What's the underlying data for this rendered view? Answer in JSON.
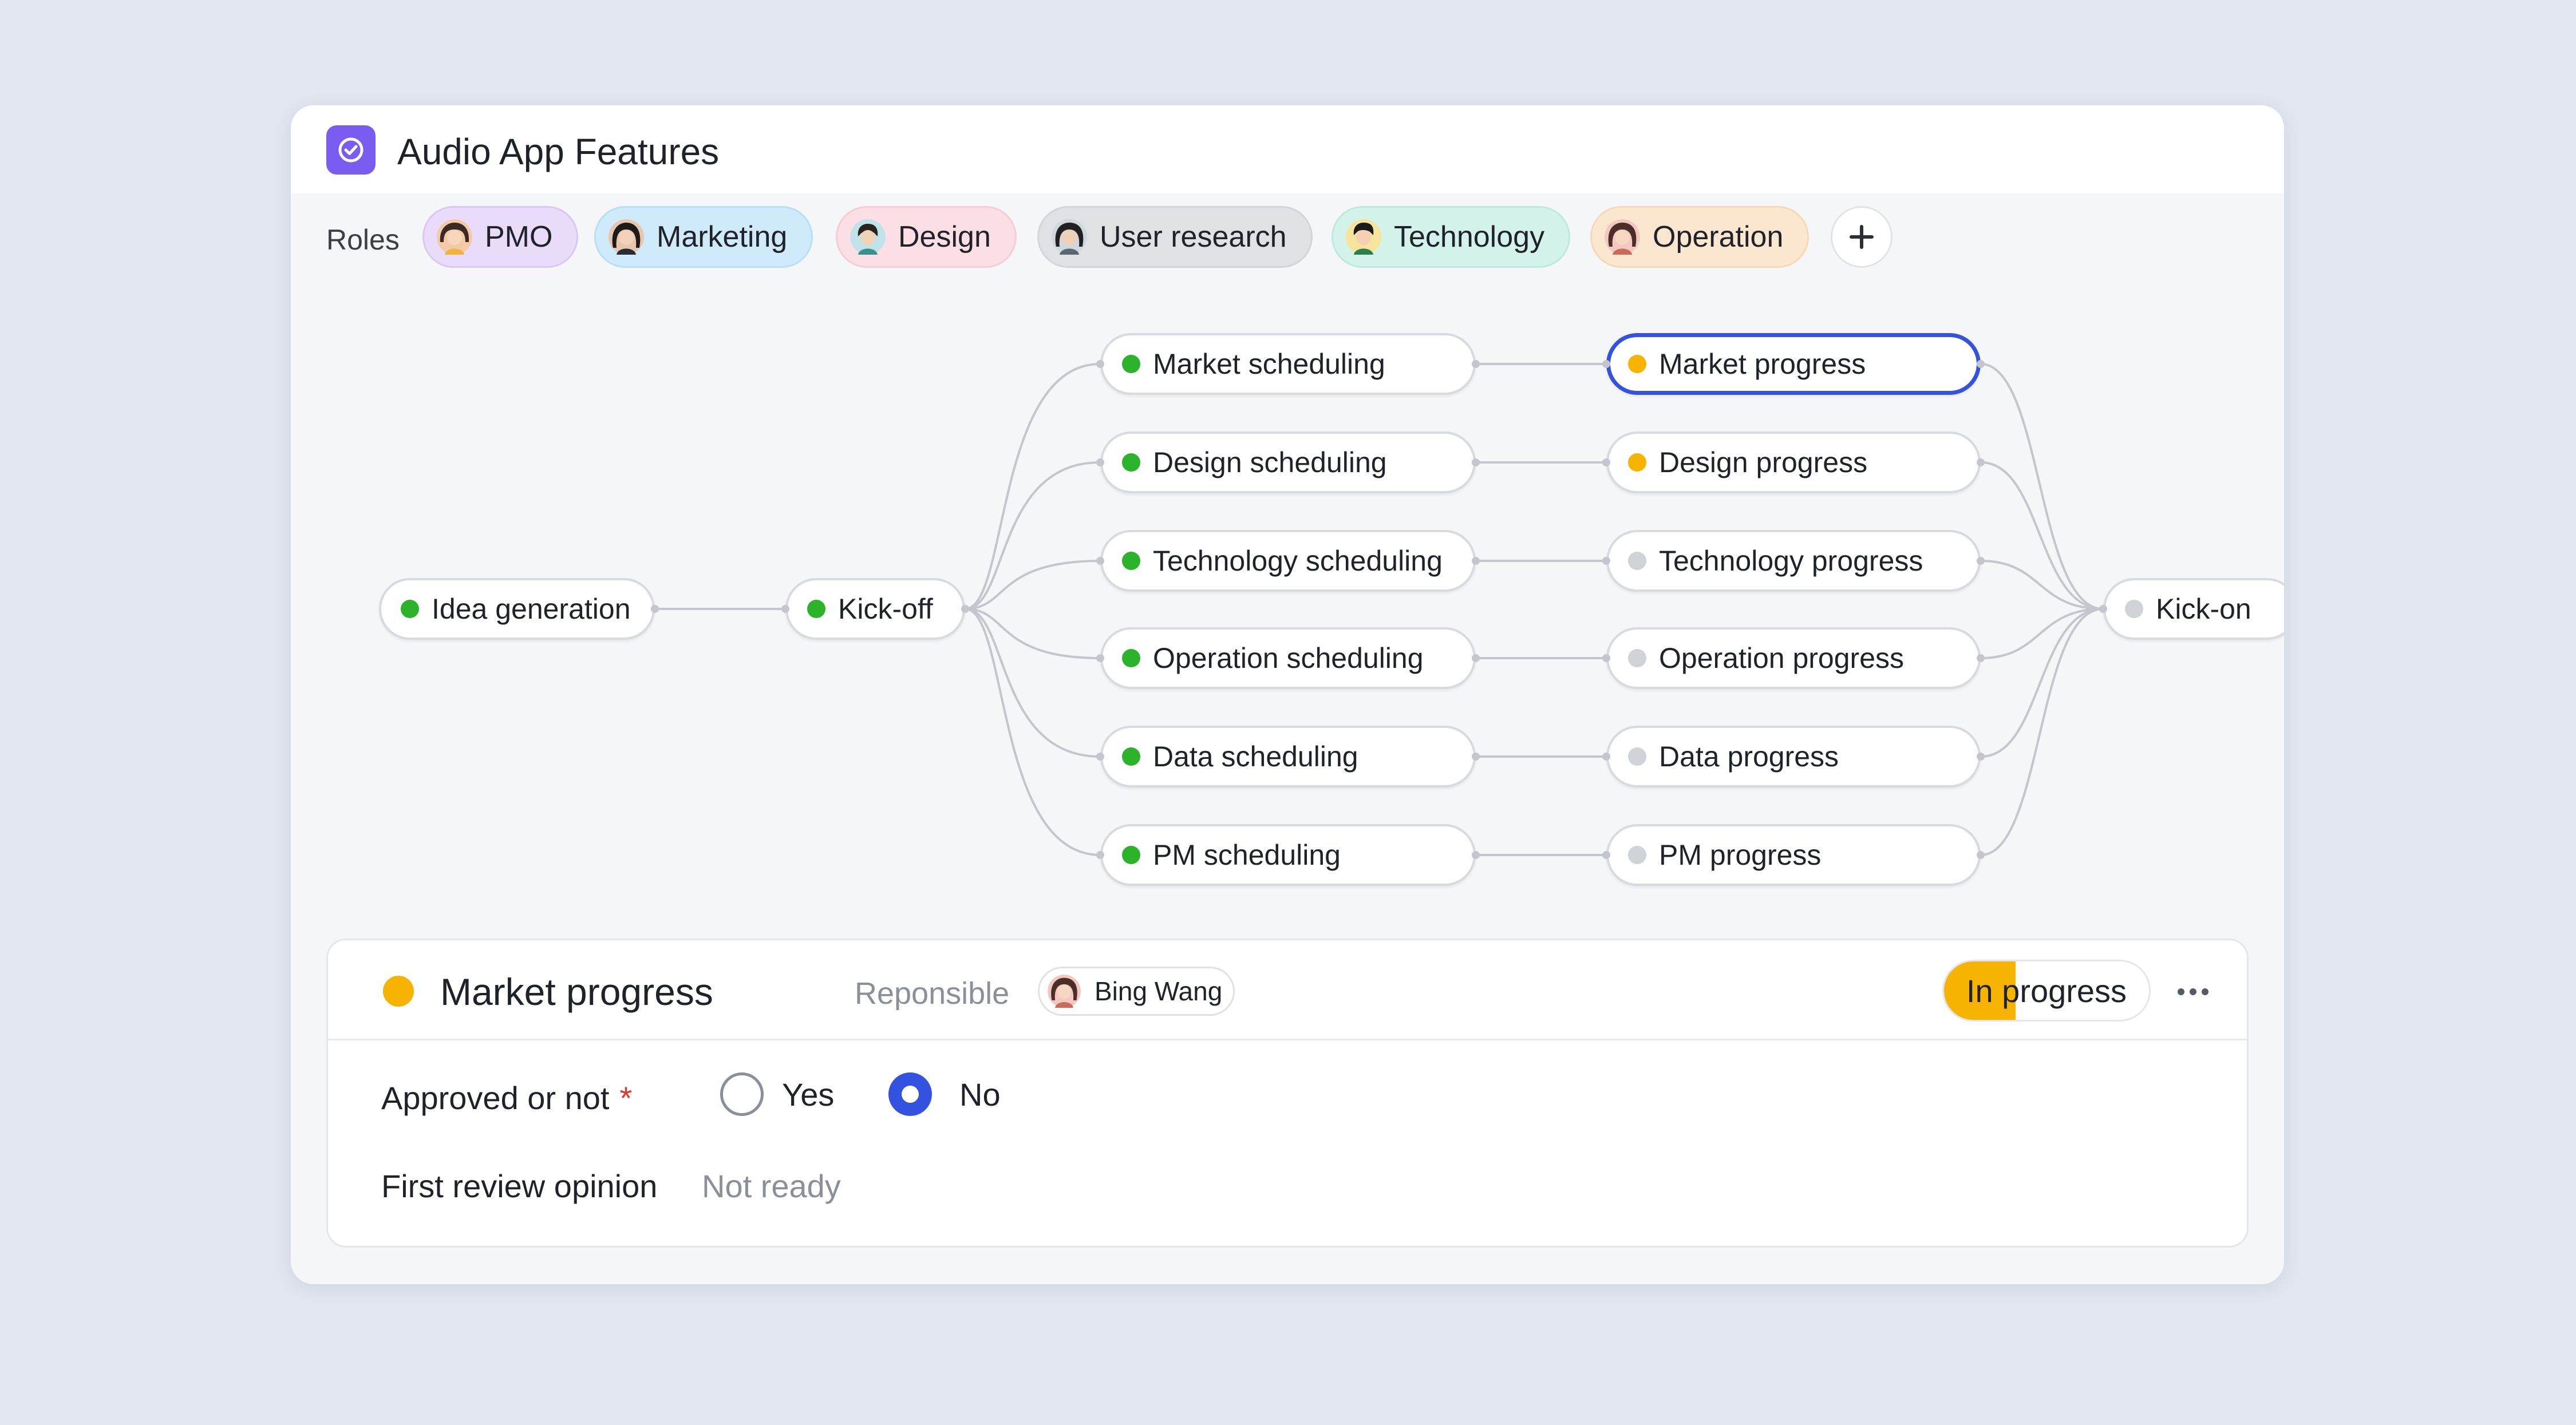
{
  "app": {
    "title": "Audio App Features",
    "icon": "check-circle-icon",
    "accent": "#7b5cf0"
  },
  "roles": {
    "label": "Roles",
    "items": [
      {
        "label": "PMO",
        "bg": "#e8dcfa",
        "border": "#d9c8f5"
      },
      {
        "label": "Marketing",
        "bg": "#cfeafb",
        "border": "#b9dff7"
      },
      {
        "label": "Design",
        "bg": "#fbdfe5",
        "border": "#f5cdd6"
      },
      {
        "label": "User research",
        "bg": "#dfe1e5",
        "border": "#d2d5da"
      },
      {
        "label": "Technology",
        "bg": "#d3f2ea",
        "border": "#bfe9de"
      },
      {
        "label": "Operation",
        "bg": "#fbe6cf",
        "border": "#f5d9b9"
      }
    ],
    "add_icon": "plus-icon"
  },
  "status_colors": {
    "done": "#2bb32b",
    "active": "#f6b400",
    "pending": "#cfd2d7",
    "selected": "#3452e0"
  },
  "flow": {
    "nodes": [
      {
        "id": "idea",
        "label": "Idea generation",
        "status": "done"
      },
      {
        "id": "kickoff",
        "label": "Kick-off",
        "status": "done"
      },
      {
        "id": "ms",
        "label": "Market scheduling",
        "status": "done"
      },
      {
        "id": "ds",
        "label": "Design scheduling",
        "status": "done"
      },
      {
        "id": "ts",
        "label": "Technology scheduling",
        "status": "done"
      },
      {
        "id": "os",
        "label": "Operation scheduling",
        "status": "done"
      },
      {
        "id": "das",
        "label": "Data scheduling",
        "status": "done"
      },
      {
        "id": "pms",
        "label": "PM scheduling",
        "status": "done"
      },
      {
        "id": "mp",
        "label": "Market progress",
        "status": "active",
        "selected": true
      },
      {
        "id": "dp",
        "label": "Design progress",
        "status": "active"
      },
      {
        "id": "tp",
        "label": "Technology progress",
        "status": "pending"
      },
      {
        "id": "op",
        "label": "Operation progress",
        "status": "pending"
      },
      {
        "id": "dap",
        "label": "Data progress",
        "status": "pending"
      },
      {
        "id": "pmp",
        "label": "PM progress",
        "status": "pending"
      },
      {
        "id": "kickon",
        "label": "Kick-on",
        "status": "pending"
      }
    ]
  },
  "detail": {
    "title": "Market progress",
    "status_dot": "#f6b400",
    "responsible_label": "Reponsible",
    "responsible_name": "Bing Wang",
    "status": {
      "label": "In progress",
      "progress": 0.35
    },
    "more_icon": "more-horizontal-icon",
    "fields": {
      "approved": {
        "label": "Approved or not",
        "required_mark": "*",
        "options": [
          "Yes",
          "No"
        ],
        "selected": "No"
      },
      "first_review": {
        "label": "First review opinion",
        "value": "Not ready"
      }
    }
  }
}
